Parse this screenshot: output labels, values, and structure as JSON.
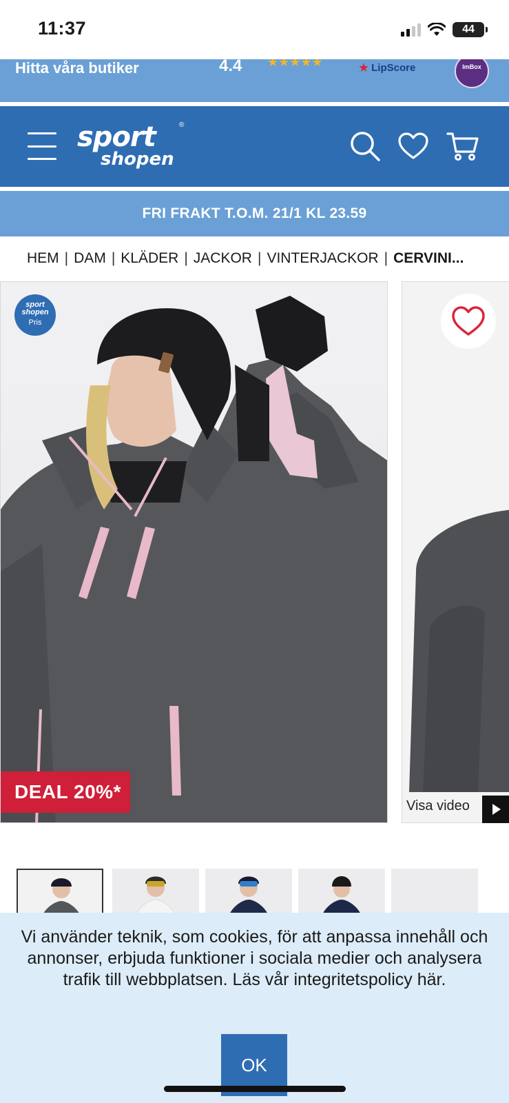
{
  "status_bar": {
    "time": "11:37",
    "battery": "44"
  },
  "info_bar": {
    "stores_link": "Hitta våra butiker",
    "rating": "4.4",
    "rating_stars": "★★★★★",
    "review_provider": "LipScore",
    "award_badge": "ImBox"
  },
  "header": {
    "logo_top": "sport",
    "logo_bottom": "shopen",
    "logo_mark": "®"
  },
  "shipping_banner": "FRI FRAKT T.O.M. 21/1 KL 23.59",
  "breadcrumb": {
    "items": [
      "HEM",
      "DAM",
      "KLÄDER",
      "JACKOR",
      "VINTERJACKOR"
    ],
    "current": "CERVINI...",
    "separator": "|"
  },
  "gallery": {
    "price_badge_logo": "sport shopen",
    "price_badge_label": "Pris",
    "deal_badge": "DEAL 20%*",
    "video_label": "Visa video"
  },
  "cookie_banner": {
    "text": "Vi använder teknik, som cookies, för att anpassa innehåll och annonser, erbjuda funktioner i sociala medier och analysera trafik till webbplatsen. Läs vår integritetspolicy här.",
    "ok_label": "OK"
  },
  "colors": {
    "brand_blue": "#2f6db3",
    "light_blue": "#6aa0d6",
    "deal_red": "#cf1f39",
    "heart_red": "#d9263a",
    "cookie_bg": "#dcecf8"
  },
  "icons": {
    "menu": "hamburger-icon",
    "search": "search-icon",
    "wishlist": "heart-icon",
    "cart": "cart-icon",
    "favorite": "heart-outline-icon",
    "play": "play-icon"
  }
}
